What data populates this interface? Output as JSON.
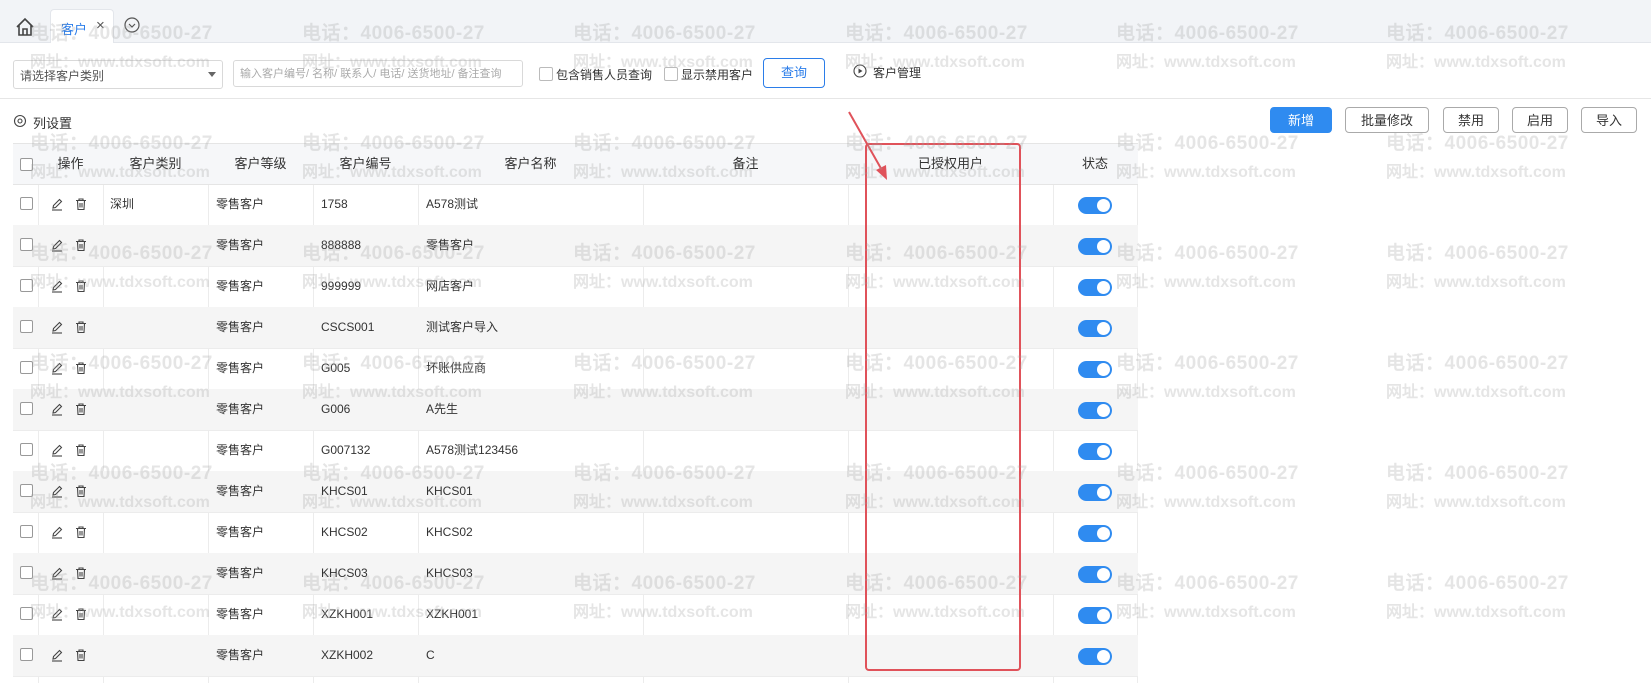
{
  "tabs": {
    "active_label": "客户",
    "close_glyph": "×"
  },
  "watermark": {
    "phone": "电话：4006-6500-27",
    "url": "网址：www.tdxsoft.com"
  },
  "filters": {
    "category_placeholder": "请选择客户类别",
    "search_placeholder": "输入客户编号/ 名称/ 联系人/ 电话/ 送货地址/ 备注查询",
    "include_sales_label": "包含销售人员查询",
    "show_disabled_label": "显示禁用客户",
    "query_label": "查询",
    "manage_label": "客户管理"
  },
  "toolbar": {
    "column_settings_label": "列设置",
    "add_label": "新增",
    "batch_edit_label": "批量修改",
    "disable_label": "禁用",
    "enable_label": "启用",
    "import_label": "导入"
  },
  "table": {
    "columns": [
      "操作",
      "客户类别",
      "客户等级",
      "客户编号",
      "客户名称",
      "备注",
      "已授权用户",
      "状态"
    ],
    "rows": [
      {
        "category": "深圳",
        "level": "零售客户",
        "code": "1758",
        "name": "A578测试",
        "note": "",
        "authorized": "",
        "enabled": true
      },
      {
        "category": "",
        "level": "零售客户",
        "code": "888888",
        "name": "零售客户",
        "note": "",
        "authorized": "",
        "enabled": true
      },
      {
        "category": "",
        "level": "零售客户",
        "code": "999999",
        "name": "网店客户",
        "note": "",
        "authorized": "",
        "enabled": true
      },
      {
        "category": "",
        "level": "零售客户",
        "code": "CSCS001",
        "name": "测试客户导入",
        "note": "",
        "authorized": "",
        "enabled": true
      },
      {
        "category": "",
        "level": "零售客户",
        "code": "G005",
        "name": "坏账供应商",
        "note": "",
        "authorized": "",
        "enabled": true
      },
      {
        "category": "",
        "level": "零售客户",
        "code": "G006",
        "name": "A先生",
        "note": "",
        "authorized": "",
        "enabled": true
      },
      {
        "category": "",
        "level": "零售客户",
        "code": "G007132",
        "name": "A578测试123456",
        "note": "",
        "authorized": "",
        "enabled": true
      },
      {
        "category": "",
        "level": "零售客户",
        "code": "KHCS01",
        "name": "KHCS01",
        "note": "",
        "authorized": "",
        "enabled": true
      },
      {
        "category": "",
        "level": "零售客户",
        "code": "KHCS02",
        "name": "KHCS02",
        "note": "",
        "authorized": "",
        "enabled": true
      },
      {
        "category": "",
        "level": "零售客户",
        "code": "KHCS03",
        "name": "KHCS03",
        "note": "",
        "authorized": "",
        "enabled": true
      },
      {
        "category": "",
        "level": "零售客户",
        "code": "XZKH001",
        "name": "XZKH001",
        "note": "",
        "authorized": "",
        "enabled": true
      },
      {
        "category": "",
        "level": "零售客户",
        "code": "XZKH002",
        "name": "C",
        "note": "",
        "authorized": "",
        "enabled": true
      }
    ]
  },
  "colors": {
    "accent": "#2f8bf0",
    "annotation": "#e0525a"
  }
}
